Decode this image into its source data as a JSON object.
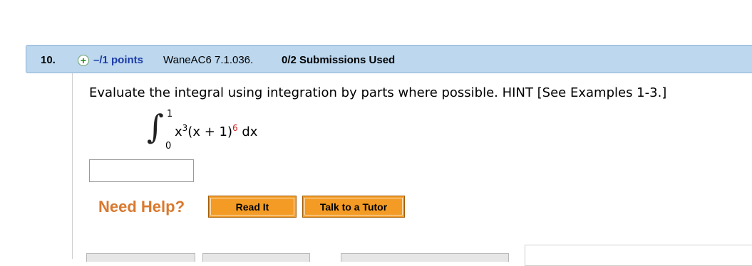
{
  "question": {
    "number": "10.",
    "points": "–/1 points",
    "code": "WaneAC6 7.1.036.",
    "submissions": "0/2 Submissions Used"
  },
  "prompt": {
    "text": "Evaluate the integral using integration by parts where possible. HINT [See Examples 1-3.]"
  },
  "integral": {
    "upper_limit": "1",
    "lower_limit": "0",
    "x_base": "x",
    "x_power": "3",
    "middle": "(x + 1)",
    "outer_power": "6",
    "differential": "dx"
  },
  "answer_input": {
    "value": ""
  },
  "help": {
    "label": "Need Help?",
    "read_it_label": "Read It",
    "tutor_label": "Talk to a Tutor"
  },
  "colors": {
    "header_bg": "#bcd7ee",
    "points_text": "#1b3ba6",
    "need_help": "#d9792e",
    "button_bg": "#f39b24",
    "exponent_highlight": "#d7191c"
  },
  "icons": {
    "expand": "plus-icon"
  }
}
